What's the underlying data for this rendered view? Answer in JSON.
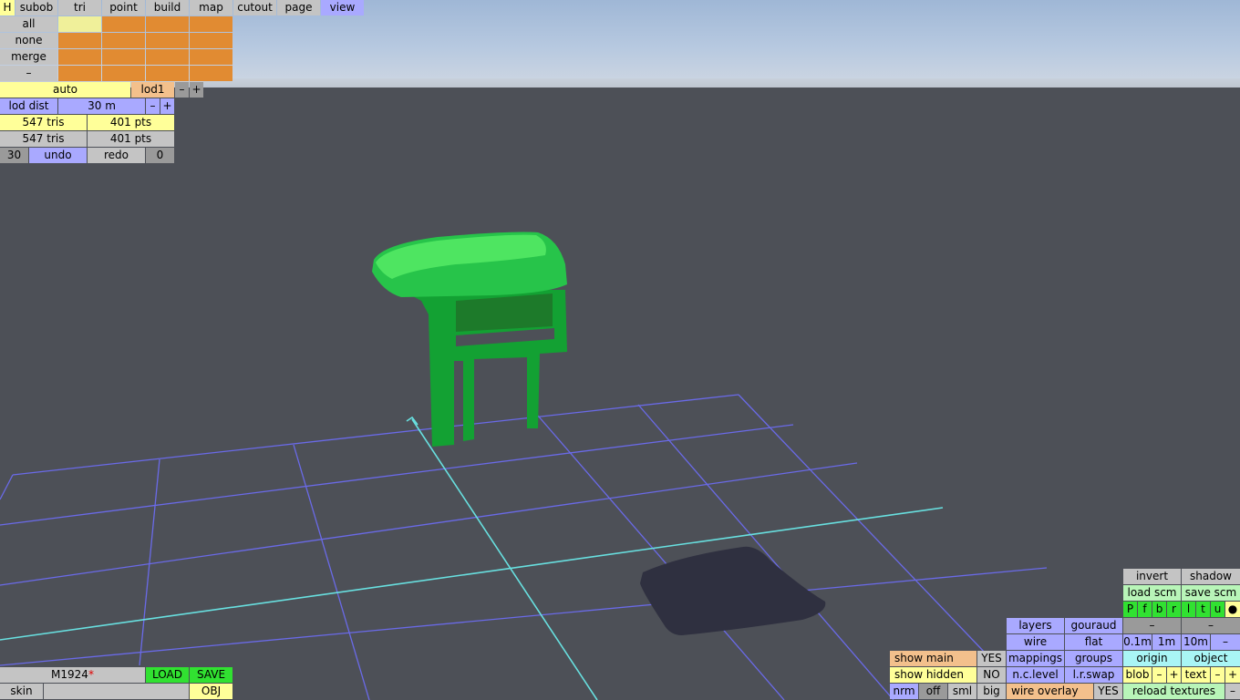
{
  "colors": {
    "model": "#27c44a",
    "model_top": "#46e85a",
    "grid": "#6a6ae8",
    "axis": "#68e0e0",
    "shadow": "#2f3040",
    "background": "#4d5057"
  },
  "menu": {
    "h": "H",
    "subob": "subob",
    "tri": "tri",
    "point": "point",
    "build": "build",
    "map": "map",
    "cutout": "cutout",
    "page": "page",
    "view": "view"
  },
  "select": {
    "all": "all",
    "none": "none",
    "merge": "merge",
    "minus": "–"
  },
  "lod": {
    "auto": "auto",
    "level": "lod1",
    "minus": "–",
    "plus": "+",
    "dist_label": "lod dist",
    "dist_value": "30 m",
    "dist_minus": "–",
    "dist_plus": "+"
  },
  "stats": {
    "tris1": "547 tris",
    "pts1": "401 pts",
    "tris2": "547 tris",
    "pts2": "401 pts"
  },
  "history": {
    "undo_count": "30",
    "undo": "undo",
    "redo": "redo",
    "redo_count": "0"
  },
  "file": {
    "name": "M1924",
    "modified_mark": "*",
    "load": "LOAD",
    "save": "SAVE",
    "skin": "skin",
    "obj": "OBJ"
  },
  "view": {
    "invert": "invert",
    "shadow": "shadow",
    "load_scm": "load scm",
    "save_scm": "save scm",
    "letters": [
      "P",
      "f",
      "b",
      "r",
      "l",
      "t",
      "u"
    ],
    "dot": "●",
    "layers": "layers",
    "gouraud": "gouraud",
    "dash1": "–",
    "dash2": "–",
    "wire": "wire",
    "flat": "flat",
    "s01": "0.1m",
    "s1": "1m",
    "s10": "10m",
    "sminus": "–",
    "show_main": "show main",
    "show_main_val": "YES",
    "mappings": "mappings",
    "groups": "groups",
    "origin": "origin",
    "object": "object",
    "show_hidden": "show hidden",
    "show_hidden_val": "NO",
    "nclevel": "n.c.level",
    "lrswap": "l.r.swap",
    "blob": "blob",
    "blob_minus": "–",
    "blob_plus": "+",
    "text": "text",
    "text_minus": "–",
    "text_plus": "+",
    "nrm": "nrm",
    "off": "off",
    "sml": "sml",
    "big": "big",
    "wire_overlay": "wire overlay",
    "wire_overlay_val": "YES",
    "reload_textures": "reload textures",
    "reload_minus": "–"
  }
}
